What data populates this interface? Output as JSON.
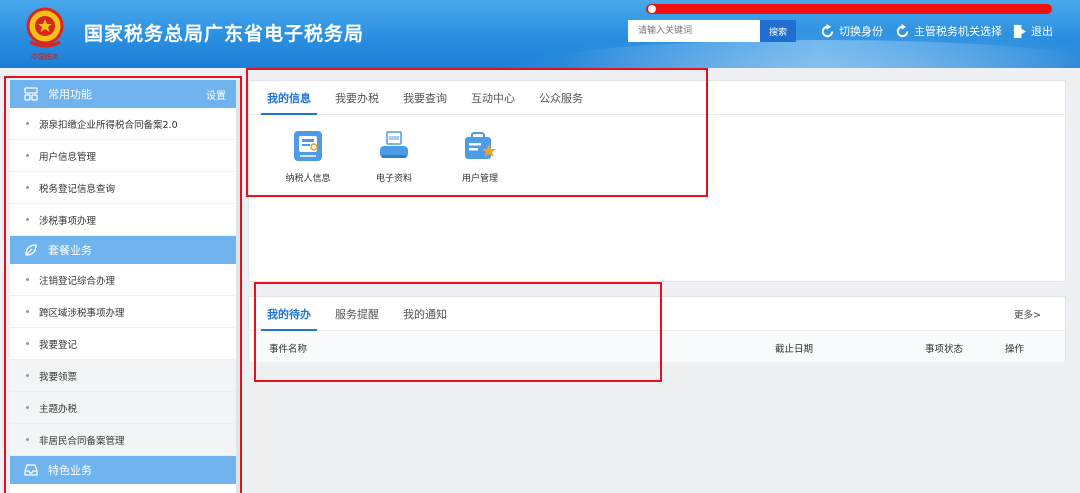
{
  "header": {
    "title": "国家税务总局广东省电子税务局",
    "search_placeholder": "请输入关键词",
    "search_button": "搜索",
    "switch_identity": "切换身份",
    "choose_authority": "主管税务机关选择",
    "logout": "退出",
    "logo_icon": "tax-emblem-icon"
  },
  "sidebar": {
    "groups": [
      {
        "label": "常用功能",
        "settings": "设置",
        "icon": "grid-icon"
      },
      {
        "label": "套餐业务",
        "icon": "leaf-icon"
      },
      {
        "label": "特色业务",
        "icon": "inbox-icon"
      }
    ],
    "common_items": [
      "源泉扣缴企业所得税合同备案2.0",
      "用户信息管理",
      "税务登记信息查询",
      "涉税事项办理"
    ],
    "package_items": [
      "注销登记综合办理",
      "跨区域涉税事项办理",
      "我要登记",
      "我要领票",
      "主题办税",
      "非居民合同备案管理"
    ]
  },
  "info_panel": {
    "tabs": [
      "我的信息",
      "我要办税",
      "我要查询",
      "互动中心",
      "公众服务"
    ],
    "tiles": [
      {
        "label": "纳税人信息",
        "icon": "taxpayer-info-icon"
      },
      {
        "label": "电子资料",
        "icon": "electronic-docs-icon"
      },
      {
        "label": "用户管理",
        "icon": "user-management-icon"
      }
    ]
  },
  "todo_panel": {
    "tabs": [
      "我的待办",
      "服务提醒",
      "我的通知"
    ],
    "more": "更多>",
    "columns": [
      "事件名称",
      "截止日期",
      "事项状态",
      "操作"
    ]
  },
  "colors": {
    "header_blue": "#2a8fe0",
    "accent_blue": "#1f74d6",
    "sidebar_group": "#6fb3ef",
    "annotation_red": "#e8101a"
  }
}
